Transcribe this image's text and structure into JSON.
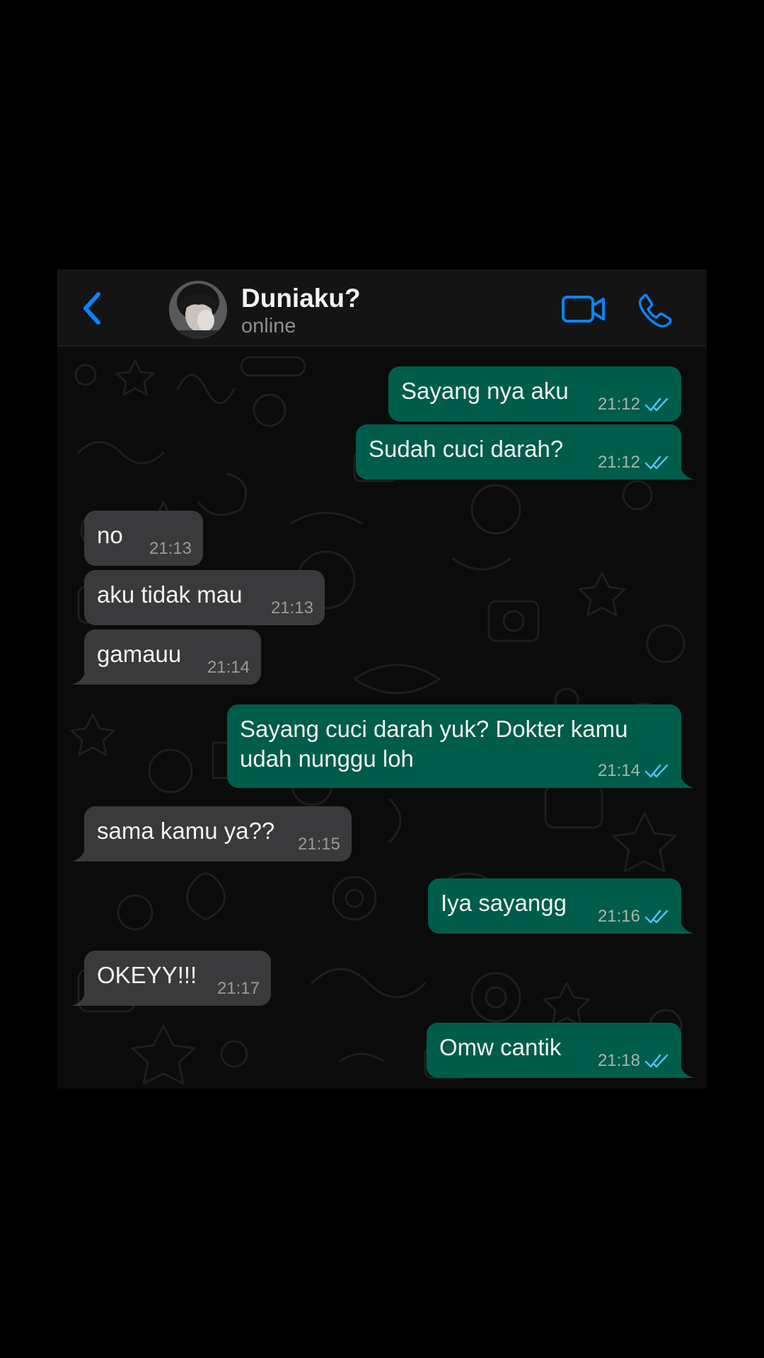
{
  "header": {
    "contact_name": "Duniaku?",
    "status": "online"
  },
  "colors": {
    "accent": "#0a84ff",
    "outgoing_bubble": "#005c4b",
    "incoming_bubble": "#3a3a3c",
    "read_ticks": "#53bdeb"
  },
  "icons": {
    "back": "chevron-left-icon",
    "video": "video-camera-icon",
    "call": "phone-icon",
    "read": "double-check-icon"
  },
  "messages": [
    {
      "direction": "out",
      "text": "Sayang nya aku",
      "time": "21:12",
      "read": true
    },
    {
      "direction": "out",
      "text": "Sudah cuci darah?",
      "time": "21:12",
      "read": true
    },
    {
      "direction": "in",
      "text": "no",
      "time": "21:13"
    },
    {
      "direction": "in",
      "text": "aku tidak mau",
      "time": "21:13"
    },
    {
      "direction": "in",
      "text": "gamauu",
      "time": "21:14"
    },
    {
      "direction": "out",
      "text_line1": "Sayang cuci darah yuk? Dokter kamu",
      "text_line2": "udah nunggu loh",
      "time": "21:14",
      "read": true
    },
    {
      "direction": "in",
      "text": "sama kamu ya??",
      "time": "21:15"
    },
    {
      "direction": "out",
      "text": "Iya sayangg",
      "time": "21:16",
      "read": true
    },
    {
      "direction": "in",
      "text": "OKEYY!!!",
      "time": "21:17"
    },
    {
      "direction": "out",
      "text": "Omw cantik",
      "time": "21:18",
      "read": true
    }
  ]
}
